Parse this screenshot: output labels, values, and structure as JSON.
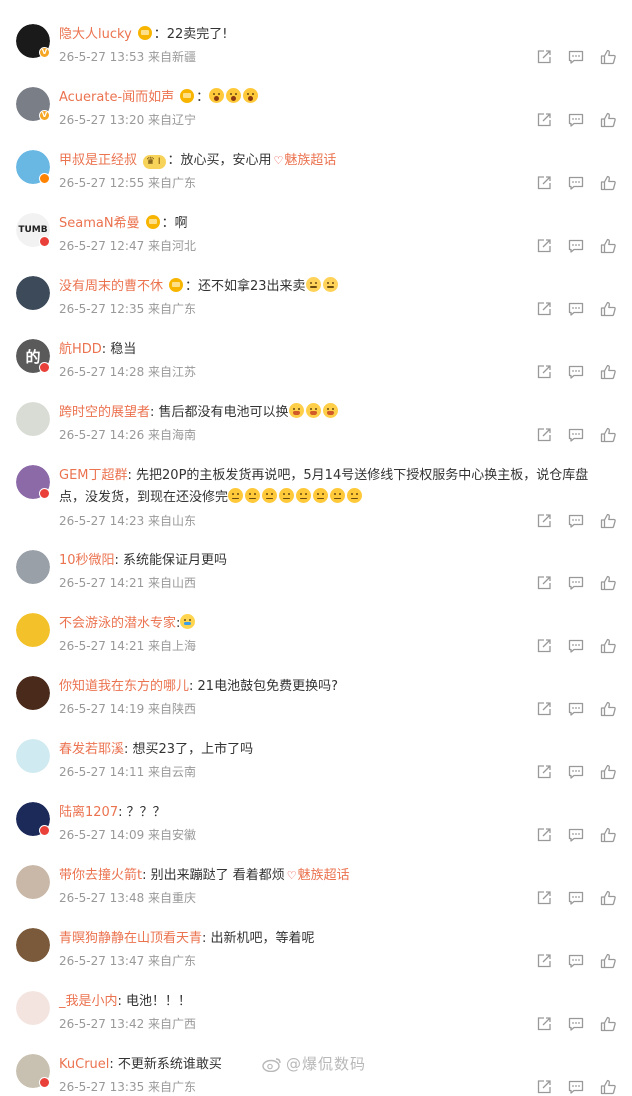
{
  "comments": [
    {
      "user": "隐大人lucky",
      "avatar_color": "#1a1a1a",
      "avatar_glyph": "",
      "verify": "gold",
      "badge": "fan",
      "text": "：22卖完了!",
      "emojis": [],
      "time": "26-5-27 13:53",
      "location": "来自新疆"
    },
    {
      "user": "Acuerate-闻而如声",
      "avatar_color": "#7a7e86",
      "avatar_glyph": "",
      "verify": "gold",
      "badge": "fan",
      "text": "：",
      "emojis": [
        "scream",
        "scream",
        "scream"
      ],
      "time": "26-5-27 13:20",
      "location": "来自辽宁"
    },
    {
      "user": "甲叔是正经叔",
      "avatar_color": "#69b7e3",
      "avatar_glyph": "",
      "verify": "orange",
      "badge": "vip",
      "vip_label": "I",
      "text": "：放心买，安心用",
      "emojis": [],
      "link": "魅族超话",
      "time": "26-5-27 12:55",
      "location": "来自广东"
    },
    {
      "user": "SeamaN希曼",
      "avatar_color": "#f2f2f2",
      "avatar_glyph": "TUMB",
      "verify": "red",
      "badge": "fan",
      "text": "：啊",
      "emojis": [],
      "time": "26-5-27 12:47",
      "location": "来自河北"
    },
    {
      "user": "没有周末的曹不休",
      "avatar_color": "#3c4a5a",
      "avatar_glyph": "",
      "verify": "",
      "badge": "fan",
      "text": "：还不如拿23出来卖",
      "emojis": [
        "grin",
        "grin"
      ],
      "time": "26-5-27 12:35",
      "location": "来自广东"
    },
    {
      "user": "航HDD",
      "avatar_color": "#5a5a5a",
      "avatar_glyph": "的",
      "verify": "red",
      "badge": "",
      "text": ": 稳当",
      "emojis": [],
      "time": "26-5-27 14:28",
      "location": "来自江苏"
    },
    {
      "user": "跨时空的展望者",
      "avatar_color": "#d8dcd4",
      "avatar_glyph": "",
      "verify": "",
      "badge": "",
      "text": ": 售后都没有电池可以换",
      "emojis": [
        "cry",
        "cry",
        "cry"
      ],
      "time": "26-5-27 14:26",
      "location": "来自海南"
    },
    {
      "user": "GEM丁超群",
      "avatar_color": "#8c6aa8",
      "avatar_glyph": "",
      "verify": "red",
      "badge": "",
      "text": ": 先把20P的主板发货再说吧，5月14号送修线下授权服务中心换主板，说仓库盘点，没发货，到现在还没修完",
      "emojis": [
        "sad",
        "sad",
        "sad",
        "sad",
        "sad",
        "sad",
        "sad",
        "sad"
      ],
      "time": "26-5-27 14:23",
      "location": "来自山东"
    },
    {
      "user": "10秒微阳",
      "avatar_color": "#9aa0a8",
      "avatar_glyph": "",
      "verify": "",
      "badge": "",
      "text": ": 系统能保证月更吗",
      "emojis": [],
      "time": "26-5-27 14:21",
      "location": "来自山西"
    },
    {
      "user": "不会游泳的潜水专家",
      "avatar_color": "#f3c22b",
      "avatar_glyph": "",
      "verify": "",
      "badge": "",
      "text": ":",
      "emojis": [
        "tears"
      ],
      "time": "26-5-27 14:21",
      "location": "来自上海"
    },
    {
      "user": "你知道我在东方的哪儿",
      "avatar_color": "#4a2a1a",
      "avatar_glyph": "",
      "verify": "",
      "badge": "",
      "text": ": 21电池鼓包免费更换吗?",
      "emojis": [],
      "time": "26-5-27 14:19",
      "location": "来自陕西"
    },
    {
      "user": "春发若耶溪",
      "avatar_color": "#cfeaf0",
      "avatar_glyph": "",
      "verify": "",
      "badge": "",
      "text": ": 想买23了，上市了吗",
      "emojis": [],
      "time": "26-5-27 14:11",
      "location": "来自云南"
    },
    {
      "user": "陆离1207",
      "avatar_color": "#1c2a5a",
      "avatar_glyph": "",
      "verify": "red",
      "badge": "",
      "text": ": ？？？",
      "emojis": [],
      "time": "26-5-27 14:09",
      "location": "来自安徽"
    },
    {
      "user": "带你去撞火箭t",
      "avatar_color": "#c9b8a8",
      "avatar_glyph": "",
      "verify": "",
      "badge": "",
      "text": ": 别出来蹦跶了 看着都烦",
      "emojis": [],
      "link": "魅族超话",
      "time": "26-5-27 13:48",
      "location": "来自重庆"
    },
    {
      "user": "青暝狗静静在山顶看天青",
      "avatar_color": "#7a5a3a",
      "avatar_glyph": "",
      "verify": "",
      "badge": "",
      "text": ": 出新机吧，等着呢",
      "emojis": [],
      "time": "26-5-27 13:47",
      "location": "来自广东"
    },
    {
      "user": "_我是小内",
      "avatar_color": "#f4e4e0",
      "avatar_glyph": "",
      "verify": "",
      "badge": "",
      "text": ": 电池！！！",
      "emojis": [],
      "time": "26-5-27 13:42",
      "location": "来自广西"
    },
    {
      "user": "KuCruel",
      "avatar_color": "#c8c0b0",
      "avatar_glyph": "",
      "verify": "red",
      "badge": "",
      "text": ": 不更新系统谁敢买",
      "emojis": [],
      "time": "26-5-27 13:35",
      "location": "来自广东"
    }
  ],
  "watermark": "@爆侃数码",
  "icons": {
    "share": "share-icon",
    "reply": "comment-icon",
    "like": "like-icon",
    "weibo": "weibo-logo-icon"
  }
}
